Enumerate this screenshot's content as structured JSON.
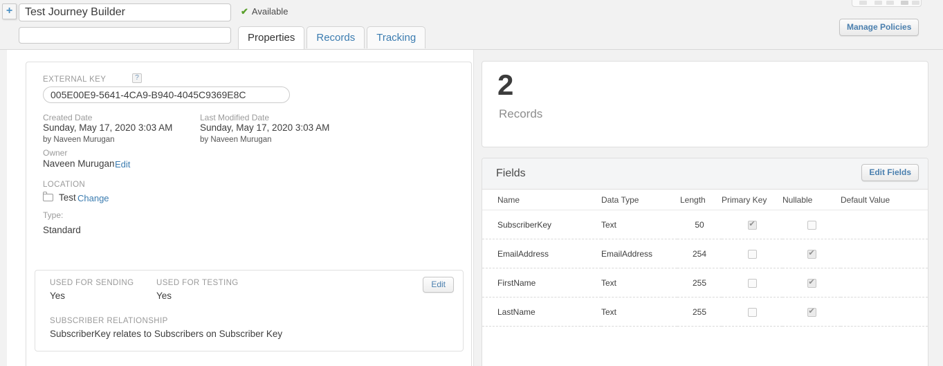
{
  "header": {
    "add_button_icon": "plus-icon",
    "name_value": "Test Journey Builder",
    "name_placeholder": "",
    "description_value": "",
    "description_placeholder": "",
    "status_text": "Available",
    "status_icon": "check-icon",
    "status_color": "#5aa02c",
    "manage_policies_label": "Manage Policies"
  },
  "tabs": [
    {
      "label": "Properties",
      "active": true
    },
    {
      "label": "Records",
      "active": false
    },
    {
      "label": "Tracking",
      "active": false
    }
  ],
  "properties": {
    "external_key_label": "EXTERNAL KEY",
    "help_icon_glyph": "?",
    "external_key_value": "005E00E9-5641-4CA9-B940-4045C9369E8C",
    "created_date_label": "Created Date",
    "created_date_value": "Sunday, May 17, 2020 3:03 AM",
    "created_by": "by Naveen Murugan",
    "last_modified_label": "Last Modified Date",
    "last_modified_value": "Sunday, May 17, 2020 3:03 AM",
    "last_modified_by": "by Naveen Murugan",
    "owner_label": "Owner",
    "owner_value": "Naveen Murugan",
    "owner_edit_label": "Edit",
    "location_label": "LOCATION",
    "location_icon": "folder-icon",
    "location_value": "Test",
    "location_change_label": "Change",
    "type_label": "Type:",
    "type_value": "Standard"
  },
  "sending": {
    "used_for_sending_label": "USED FOR SENDING",
    "used_for_sending_value": "Yes",
    "used_for_testing_label": "USED FOR TESTING",
    "used_for_testing_value": "Yes",
    "subscriber_relationship_label": "SUBSCRIBER RELATIONSHIP",
    "subscriber_relationship_value": "SubscriberKey relates to Subscribers on Subscriber Key",
    "edit_label": "Edit"
  },
  "records": {
    "count": "2",
    "caption": "Records"
  },
  "fields": {
    "title": "Fields",
    "edit_button_label": "Edit Fields",
    "columns": [
      "Name",
      "Data Type",
      "Length",
      "Primary Key",
      "Nullable",
      "Default Value"
    ],
    "rows": [
      {
        "name": "SubscriberKey",
        "data_type": "Text",
        "length": "50",
        "primary_key": true,
        "nullable": false,
        "default_value": ""
      },
      {
        "name": "EmailAddress",
        "data_type": "EmailAddress",
        "length": "254",
        "primary_key": false,
        "nullable": true,
        "default_value": ""
      },
      {
        "name": "FirstName",
        "data_type": "Text",
        "length": "255",
        "primary_key": false,
        "nullable": true,
        "default_value": ""
      },
      {
        "name": "LastName",
        "data_type": "Text",
        "length": "255",
        "primary_key": false,
        "nullable": true,
        "default_value": ""
      }
    ]
  }
}
